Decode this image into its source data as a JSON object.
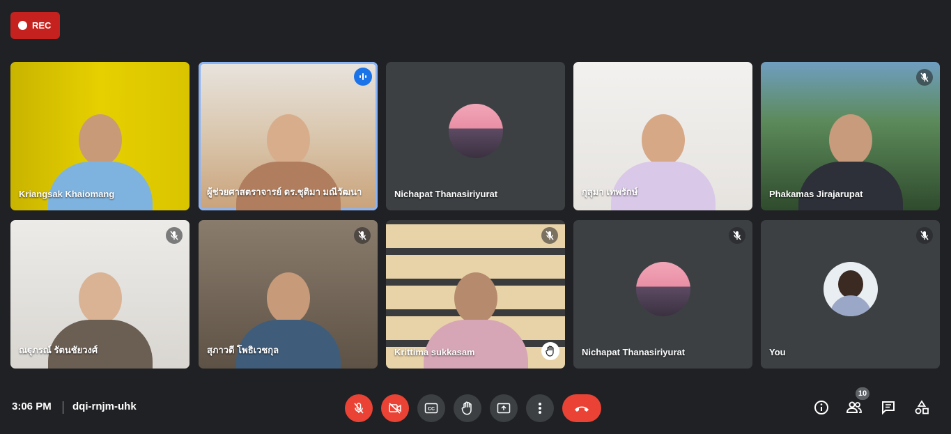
{
  "recording": {
    "label": "REC"
  },
  "tiles": [
    {
      "name": "Kriangsak Khaiomang"
    },
    {
      "name": "ผู้ช่วยศาสตราจารย์ ดร.ชุติมา มณีวัฒนา"
    },
    {
      "name": "Nichapat Thanasiriyurat"
    },
    {
      "name": "กุสุมา เทพรักษ์"
    },
    {
      "name": "Phakamas Jirajarupat"
    },
    {
      "name": "ณฐุภรณ์ รัตนชัยวงศ์"
    },
    {
      "name": "สุภาวดี โพธิเวชกุล"
    },
    {
      "name": "Krittima sukkasam"
    },
    {
      "name": "Nichapat Thanasiriyurat"
    },
    {
      "name": "You"
    }
  ],
  "meeting": {
    "time": "3:06 PM",
    "code": "dqi-rnjm-uhk"
  },
  "people": {
    "count": "10"
  },
  "colors": {
    "background": "#202124",
    "tile": "#3c4043",
    "danger": "#ea4335",
    "active": "#8ab4f8"
  },
  "icons": {
    "controls": [
      "mic-off-icon",
      "camera-off-icon",
      "captions-icon",
      "raise-hand-icon",
      "present-icon",
      "more-icon",
      "end-call-icon"
    ],
    "right": [
      "info-icon",
      "people-icon",
      "chat-icon",
      "activities-icon"
    ]
  }
}
